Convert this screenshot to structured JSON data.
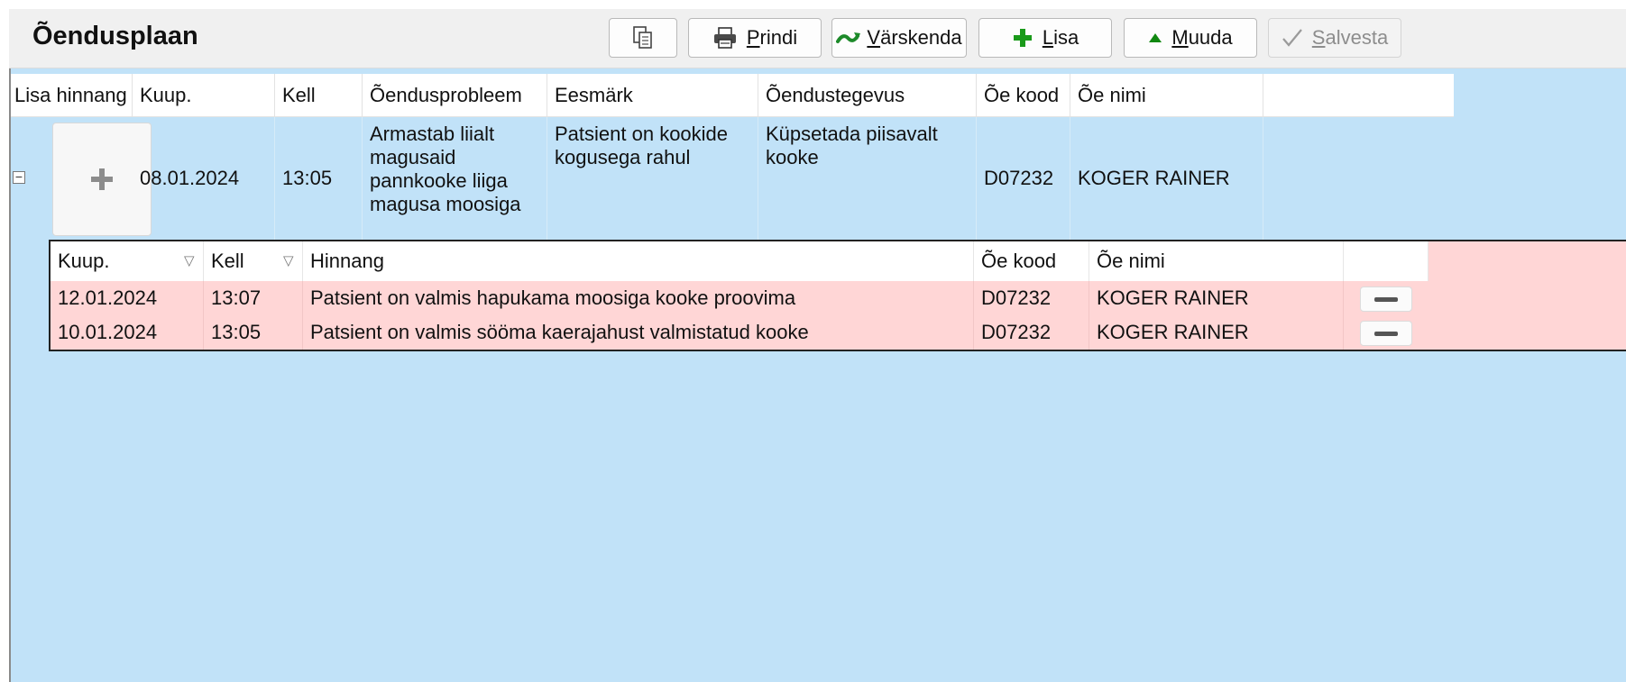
{
  "window": {
    "title": "Õendusplaan"
  },
  "toolbar": {
    "copy_icon": "copy-icon",
    "print_label": "Prindi",
    "refresh_label": "Värskenda",
    "add_label": "Lisa",
    "edit_label": "Muuda",
    "save_label": "Salvesta"
  },
  "grid": {
    "columns": [
      "Lisa hinnang",
      "Kuup.",
      "Kell",
      "Õendusprobleem",
      "Eesmärk",
      "Õendustegevus",
      "Õe kood",
      "Õe nimi"
    ],
    "rows": [
      {
        "date": "08.01.2024",
        "time": "13:05",
        "problem": "Armastab liialt magusaid pannkooke liiga magusa moosiga",
        "goal": "Patsient on kookide kogusega rahul",
        "activity": "Küpsetada piisavalt kooke",
        "nurse_code": "D07232",
        "nurse_name": "KOGER RAINER",
        "assessments": {
          "columns": [
            "Kuup.",
            "Kell",
            "Hinnang",
            "Õe kood",
            "Õe nimi"
          ],
          "rows": [
            {
              "date": "12.01.2024",
              "time": "13:07",
              "assessment": "Patsient on valmis hapukama moosiga kooke proovima",
              "nurse_code": "D07232",
              "nurse_name": "KOGER RAINER"
            },
            {
              "date": "10.01.2024",
              "time": "13:05",
              "assessment": "Patsient on valmis sööma kaerajahust valmistatud kooke",
              "nurse_code": "D07232",
              "nurse_name": "KOGER RAINER"
            }
          ]
        }
      }
    ]
  },
  "colors": {
    "row_blue": "#c1e2f8",
    "sub_row_pink": "#ffd6d6",
    "add_icon_green": "#1a9a1a",
    "refresh_icon_green": "#1d8a2a",
    "edit_icon_green": "#118811"
  }
}
